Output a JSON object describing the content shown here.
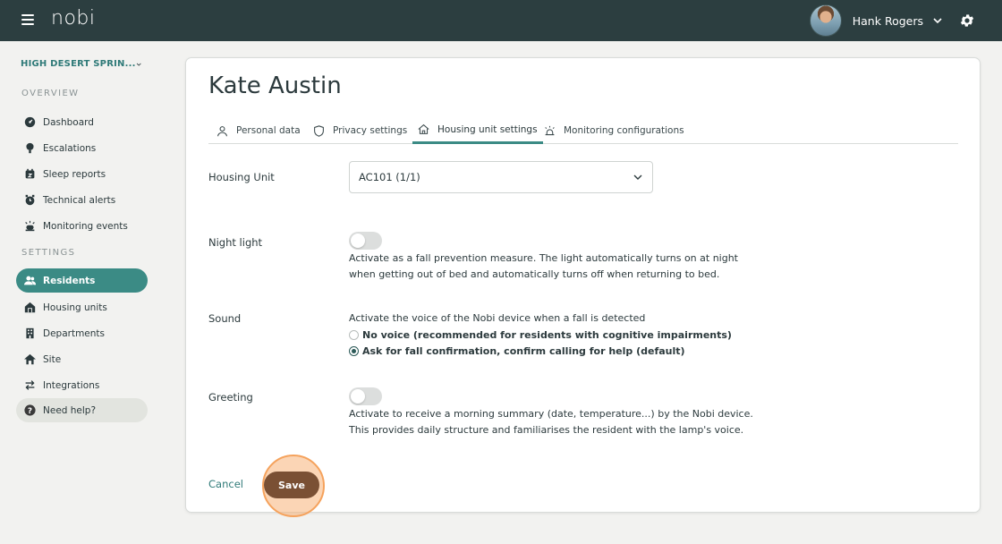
{
  "app": {
    "logo": "nobi"
  },
  "user": {
    "name": "Hank Rogers"
  },
  "sidebar": {
    "site": "HIGH DESERT SPRIN...",
    "overview_label": "OVERVIEW",
    "settings_label": "SETTINGS",
    "overview_items": [
      {
        "label": "Dashboard",
        "icon": "dashboard-icon"
      },
      {
        "label": "Escalations",
        "icon": "escalations-icon"
      },
      {
        "label": "Sleep reports",
        "icon": "sleep-reports-icon"
      },
      {
        "label": "Technical alerts",
        "icon": "technical-alerts-icon"
      },
      {
        "label": "Monitoring events",
        "icon": "monitoring-events-icon"
      }
    ],
    "settings_items": [
      {
        "label": "Residents",
        "icon": "residents-icon",
        "active": true
      },
      {
        "label": "Housing units",
        "icon": "housing-units-icon"
      },
      {
        "label": "Departments",
        "icon": "departments-icon"
      },
      {
        "label": "Site",
        "icon": "site-icon"
      },
      {
        "label": "Integrations",
        "icon": "integrations-icon"
      }
    ],
    "help": {
      "label": "Need help?",
      "icon": "help-icon"
    }
  },
  "main": {
    "title": "Kate Austin",
    "tabs": [
      {
        "label": "Personal data",
        "icon": "person-icon"
      },
      {
        "label": "Privacy settings",
        "icon": "shield-icon"
      },
      {
        "label": "Housing unit settings",
        "icon": "home-icon",
        "active": true
      },
      {
        "label": "Monitoring configurations",
        "icon": "alarm-icon"
      }
    ],
    "housing_unit": {
      "label": "Housing Unit",
      "value": "AC101 (1/1)"
    },
    "night_light": {
      "label": "Night light",
      "enabled": false,
      "desc_line1": "Activate as a fall prevention measure. The light automatically turns on at night",
      "desc_line2": "when getting out of bed and automatically turns off when returning to bed."
    },
    "sound": {
      "label": "Sound",
      "desc": "Activate the voice of the Nobi device when a fall is detected",
      "options": [
        {
          "label": "No voice (recommended for residents with cognitive impairments)",
          "selected": false
        },
        {
          "label": "Ask for fall confirmation, confirm calling for help (default)",
          "selected": true
        }
      ]
    },
    "greeting": {
      "label": "Greeting",
      "enabled": false,
      "desc_line1": "Activate to receive a morning summary (date, temperature...) by the Nobi device.",
      "desc_line2": "This provides daily structure and familiarises the resident with the lamp's voice."
    },
    "actions": {
      "cancel": "Cancel",
      "save": "Save"
    }
  },
  "colors": {
    "topbar": "#2c3e40",
    "accent": "#3b8b85",
    "save": "#7a5034",
    "highlight": "#f5a25c"
  }
}
